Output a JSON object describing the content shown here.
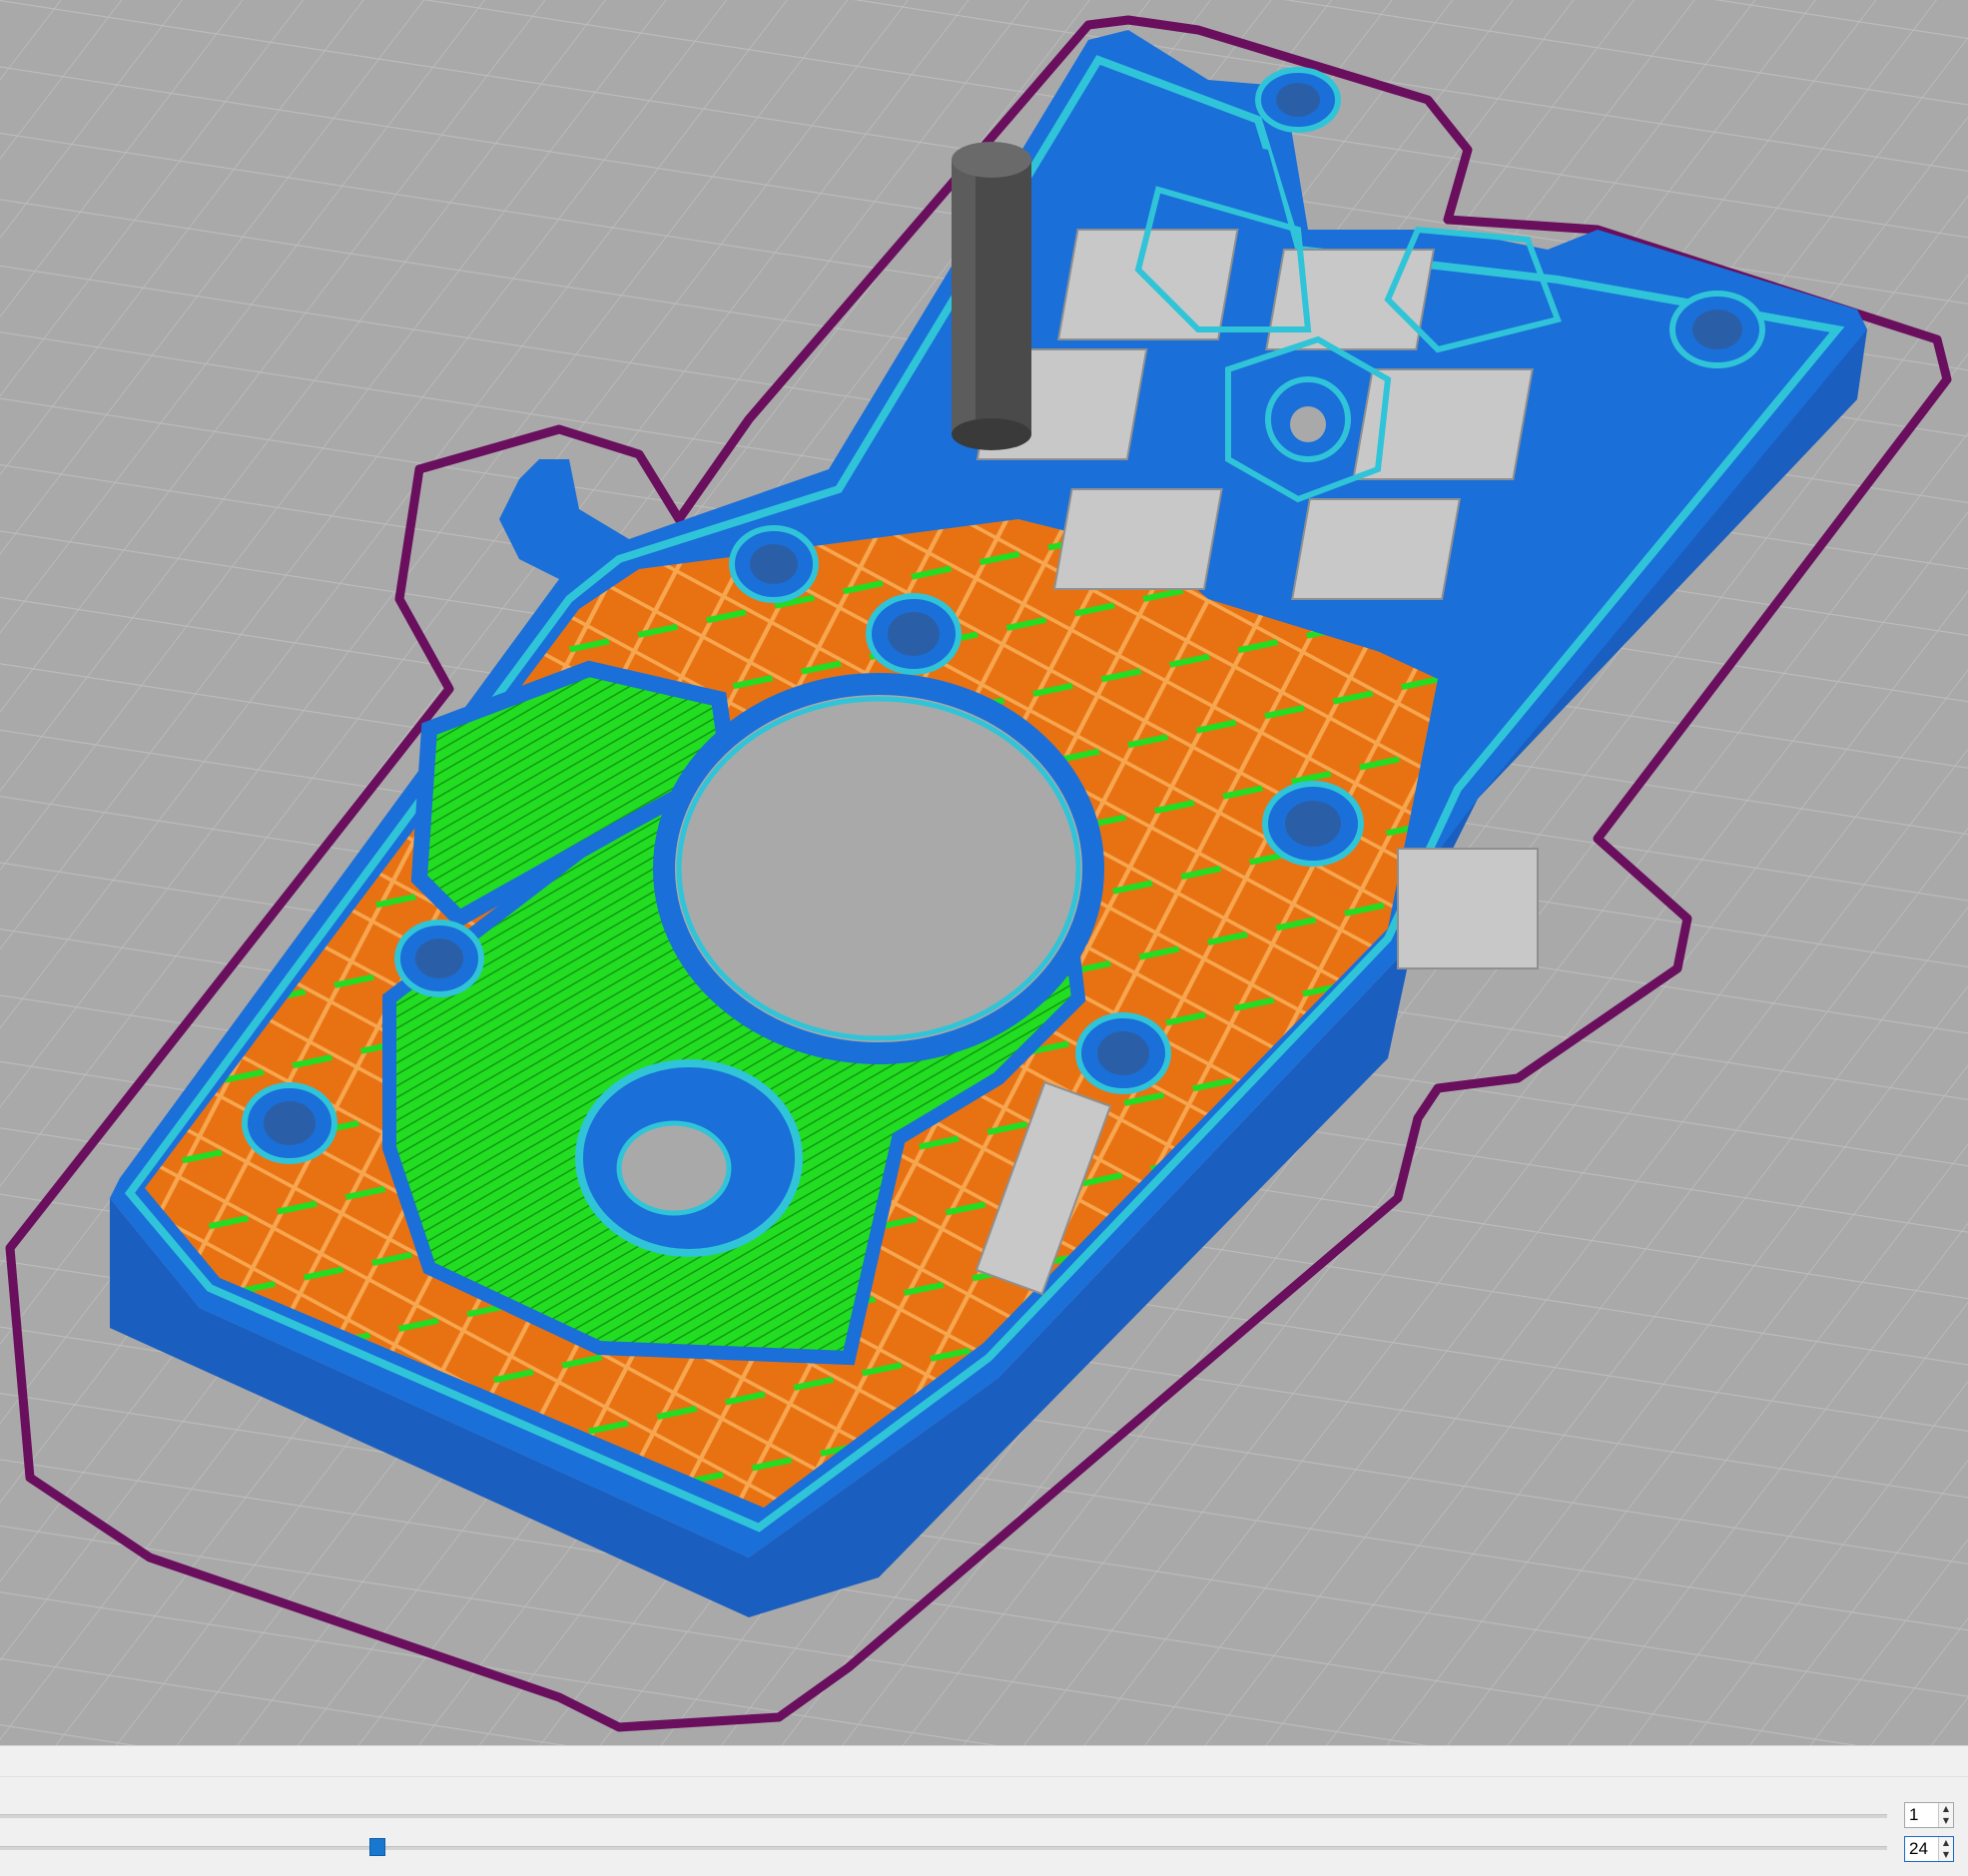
{
  "app": {
    "view": "slicer-3d-preview",
    "legend_colors": {
      "perimeter": "#1a6fd8",
      "external_perimeter": "#30c4d8",
      "infill": "#e87212",
      "solid_infill": "#22dd22",
      "support": "#c8c8c8",
      "skirt": "#6a0f5e",
      "wipe_tower": "#444444",
      "bed": "#a9a9a9",
      "grid_line": "#bdbdbd"
    }
  },
  "layer_slider": {
    "min_value": "1",
    "max_value": "24",
    "position": 0.196
  }
}
